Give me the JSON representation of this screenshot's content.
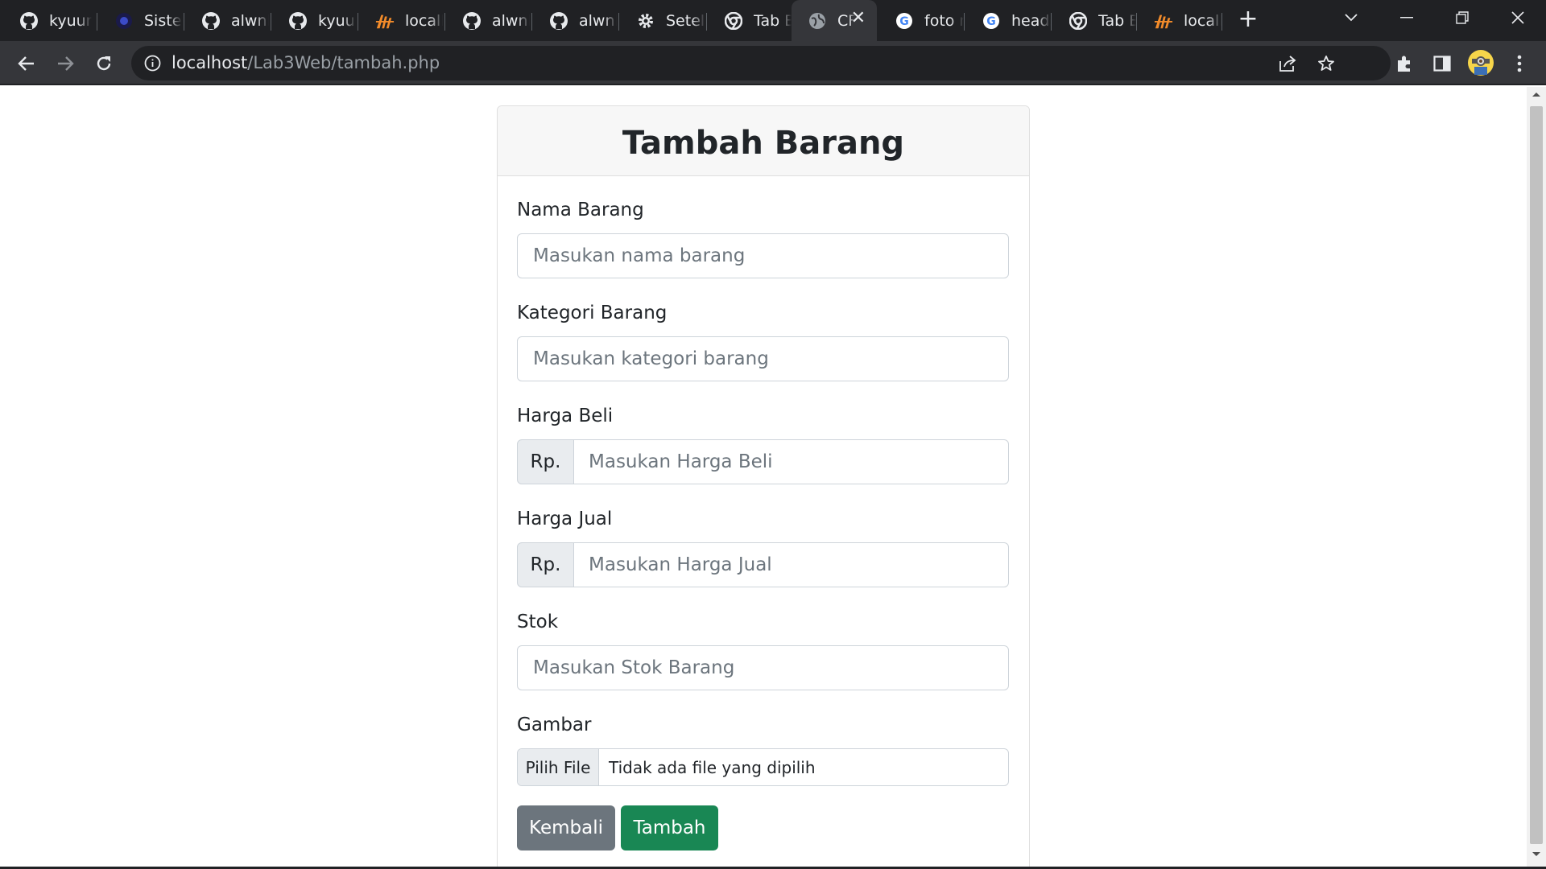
{
  "browser": {
    "tabs": [
      {
        "title": "kyuur",
        "icon": "github-icon"
      },
      {
        "title": "Sisten",
        "icon": "app-icon"
      },
      {
        "title": "alwnlt",
        "icon": "github-icon"
      },
      {
        "title": "kyuur",
        "icon": "github-icon"
      },
      {
        "title": "localh",
        "icon": "xampp-icon"
      },
      {
        "title": "alwnlt",
        "icon": "github-icon"
      },
      {
        "title": "alwnlt",
        "icon": "github-icon"
      },
      {
        "title": "Setela",
        "icon": "settings-icon"
      },
      {
        "title": "Tab B",
        "icon": "chrome-icon"
      },
      {
        "title": "CF",
        "icon": "globe-icon",
        "active": true
      },
      {
        "title": "foto n",
        "icon": "google-icon"
      },
      {
        "title": "heads",
        "icon": "google-icon"
      },
      {
        "title": "Tab B",
        "icon": "chrome-icon"
      },
      {
        "title": "localh",
        "icon": "xampp-icon"
      }
    ],
    "url_host": "localhost",
    "url_path": "/Lab3Web/tambah.php"
  },
  "page": {
    "title": "Tambah Barang",
    "fields": {
      "nama": {
        "label": "Nama Barang",
        "placeholder": "Masukan nama barang"
      },
      "kategori": {
        "label": "Kategori Barang",
        "placeholder": "Masukan kategori barang"
      },
      "harga_beli": {
        "label": "Harga Beli",
        "prefix": "Rp.",
        "placeholder": "Masukan Harga Beli"
      },
      "harga_jual": {
        "label": "Harga Jual",
        "prefix": "Rp.",
        "placeholder": "Masukan Harga Jual"
      },
      "stok": {
        "label": "Stok",
        "placeholder": "Masukan Stok Barang"
      },
      "gambar": {
        "label": "Gambar",
        "button": "Pilih File",
        "status": "Tidak ada file yang dipilih"
      }
    },
    "buttons": {
      "back": "Kembali",
      "submit": "Tambah"
    },
    "colors": {
      "secondary": "#6c757d",
      "success": "#198754"
    }
  }
}
